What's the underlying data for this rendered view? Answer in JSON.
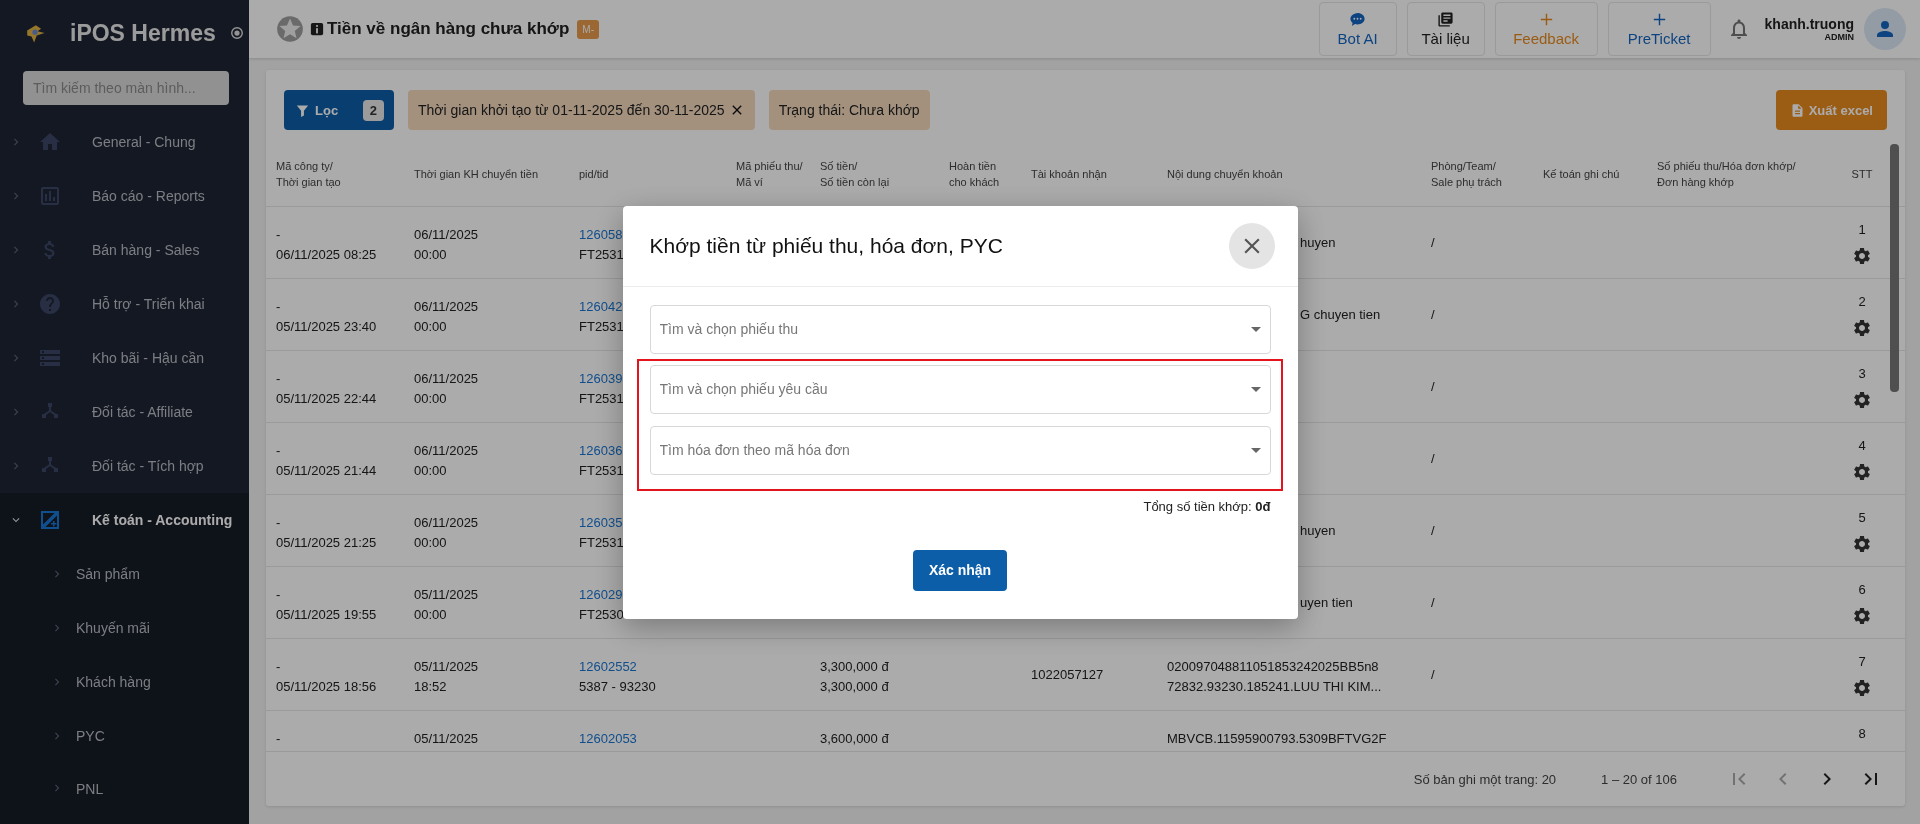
{
  "sidebar": {
    "brand": "iPOS Hermes",
    "search": {
      "placeholder": "Tìm kiếm theo màn hình..."
    },
    "items": [
      {
        "label": "General - Chung",
        "expanded": false,
        "selected": false
      },
      {
        "label": "Báo cáo - Reports",
        "expanded": false,
        "selected": false
      },
      {
        "label": "Bán hàng - Sales",
        "expanded": false,
        "selected": false
      },
      {
        "label": "Hỗ trợ - Triển khai",
        "expanded": false,
        "selected": false
      },
      {
        "label": "Kho bãi - Hậu cần",
        "expanded": false,
        "selected": false
      },
      {
        "label": "Đối tác - Affiliate",
        "expanded": false,
        "selected": false
      },
      {
        "label": "Đối tác - Tích hợp",
        "expanded": false,
        "selected": false
      },
      {
        "label": "Kế toán - Accounting",
        "expanded": true,
        "selected": true,
        "children": [
          {
            "label": "Sản phẩm"
          },
          {
            "label": "Khuyến mãi"
          },
          {
            "label": "Khách hàng"
          },
          {
            "label": "PYC"
          },
          {
            "label": "PNL"
          }
        ]
      }
    ]
  },
  "header": {
    "title": "Tiền về ngân hàng chưa khớp",
    "badge": "M-",
    "buttons": [
      {
        "label": "Bot AI",
        "kind": "chat"
      },
      {
        "label": "Tài liệu",
        "kind": "docs"
      },
      {
        "label": "Feedback",
        "kind": "feedback"
      },
      {
        "label": "PreTicket",
        "kind": "ticket"
      }
    ],
    "user": {
      "name": "khanh.truong",
      "role": "ADMIN"
    }
  },
  "filters": {
    "button": {
      "label": "Lọc",
      "count": "2"
    },
    "chips": [
      {
        "label": "Thời gian khởi tạo từ 01-11-2025 đến 30-11-2025",
        "removable": true
      },
      {
        "label": "Trạng thái: Chưa khớp",
        "removable": false
      }
    ],
    "export": "Xuất excel"
  },
  "table": {
    "columns": [
      "Mã công ty/\nThời gian tạo",
      "Thời gian KH chuyển tiền",
      "pid/tid",
      "Mã phiếu thu/\nMã ví",
      "Số tiền/\nSố tiền còn lại",
      "Hoàn tiền\ncho khách",
      "Tài khoản nhận",
      "Nội dung chuyển khoản",
      "Phòng/Team/\nSale phụ trách",
      "Kế toán ghi chú",
      "Số phiếu thu/Hóa đơn khớp/\nĐơn hàng khớp",
      "STT"
    ],
    "rows": [
      {
        "created": [
          "-",
          "06/11/2025 08:25"
        ],
        "transfer": [
          "06/11/2025",
          "00:00"
        ],
        "pid": [
          "126058",
          "FT2531"
        ],
        "content": [
          "huyen"
        ],
        "team": "/",
        "stt": "1"
      },
      {
        "created": [
          "-",
          "05/11/2025 23:40"
        ],
        "transfer": [
          "06/11/2025",
          "00:00"
        ],
        "pid": [
          "126042",
          "FT2531"
        ],
        "content": [
          "G chuyen tien"
        ],
        "team": "/",
        "stt": "2"
      },
      {
        "created": [
          "-",
          "05/11/2025 22:44"
        ],
        "transfer": [
          "06/11/2025",
          "00:00"
        ],
        "pid": [
          "126039",
          "FT2531"
        ],
        "team": "/",
        "stt": "3"
      },
      {
        "created": [
          "-",
          "05/11/2025 21:44"
        ],
        "transfer": [
          "06/11/2025",
          "00:00"
        ],
        "pid": [
          "126036",
          "FT2531"
        ],
        "team": "/",
        "stt": "4"
      },
      {
        "created": [
          "-",
          "05/11/2025 21:25"
        ],
        "transfer": [
          "06/11/2025",
          "00:00"
        ],
        "pid": [
          "126035",
          "FT2531"
        ],
        "content": [
          "huyen"
        ],
        "team": "/",
        "stt": "5"
      },
      {
        "created": [
          "-",
          "05/11/2025 19:55"
        ],
        "transfer": [
          "05/11/2025",
          "00:00"
        ],
        "pid": [
          "126029",
          "FT2530"
        ],
        "content": [
          "uyen tien"
        ],
        "team": "/",
        "stt": "6"
      },
      {
        "created": [
          "-",
          "05/11/2025 18:56"
        ],
        "transfer": [
          "05/11/2025",
          "18:52"
        ],
        "pid": [
          "12602552",
          "5387 - 93230"
        ],
        "amount": [
          "3,300,000 đ",
          "3,300,000 đ"
        ],
        "account": "1022057127",
        "content": [
          "020097048811051853242025BB5n8",
          "72832.93230.185241.LUU THI KIM..."
        ],
        "team": "/",
        "stt": "7"
      },
      {
        "created": [
          "-"
        ],
        "transfer": [
          "05/11/2025"
        ],
        "pid": [
          "12602053"
        ],
        "amount": [
          "3,600,000 đ"
        ],
        "content": [
          "MBVCB.11595900793.5309BFTVG2F"
        ],
        "stt": "8"
      }
    ]
  },
  "pagination": {
    "per_page": "Số bản ghi một trang: 20",
    "range": "1 – 20 of 106",
    "buttons": [
      {
        "disabled": true
      },
      {
        "disabled": true
      },
      {
        "disabled": false
      },
      {
        "disabled": false
      }
    ]
  },
  "modal": {
    "title": "Khớp tiền từ phiếu thu, hóa đơn, PYC",
    "fields": [
      {
        "placeholder": "Tìm và chọn phiếu thu",
        "highlighted": false
      },
      {
        "placeholder": "Tìm và chọn phiếu yêu cầu",
        "highlighted": true
      },
      {
        "placeholder": "Tìm hóa đơn theo mã hóa đơn",
        "highlighted": true
      }
    ],
    "total": "Tổng số tiền khớp: **0đ**",
    "confirm": "Xác nhận"
  }
}
